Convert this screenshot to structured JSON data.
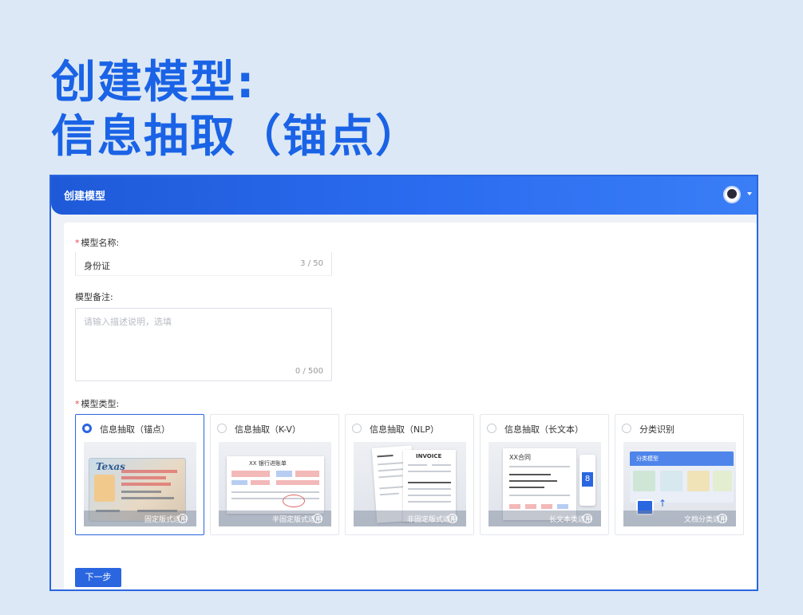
{
  "headline": {
    "line1": "创建模型:",
    "line2": "信息抽取（锚点）"
  },
  "window": {
    "title": "创建模型"
  },
  "form": {
    "name_label": "模型名称:",
    "name_value": "身份证",
    "name_count": "3 / 50",
    "remark_label": "模型备注:",
    "remark_placeholder": "请输入描述说明，选填",
    "remark_count": "0 / 500",
    "type_label": "模型类型:",
    "next_button": "下一步"
  },
  "model_types": [
    {
      "title": "信息抽取（锚点）",
      "footer": "固定版式适用",
      "selected": true
    },
    {
      "title": "信息抽取（K-V）",
      "footer": "半固定版式适用",
      "selected": false
    },
    {
      "title": "信息抽取（NLP）",
      "footer": "非固定版式适用",
      "selected": false
    },
    {
      "title": "信息抽取（长文本）",
      "footer": "长文本类适用",
      "selected": false
    },
    {
      "title": "分类识别",
      "footer": "文档分类适用",
      "selected": false
    }
  ],
  "thumbs": {
    "id_state": "Texas",
    "kv_title": "XX 银行进账单",
    "nlp_title": "INVOICE",
    "long_title": "XX合同",
    "long_page": "8",
    "classify_title": "分类模型"
  },
  "colors": {
    "accent": "#2a66e0",
    "headline": "#1a63e6",
    "background": "#dce8f5",
    "required": "#e5484d"
  }
}
